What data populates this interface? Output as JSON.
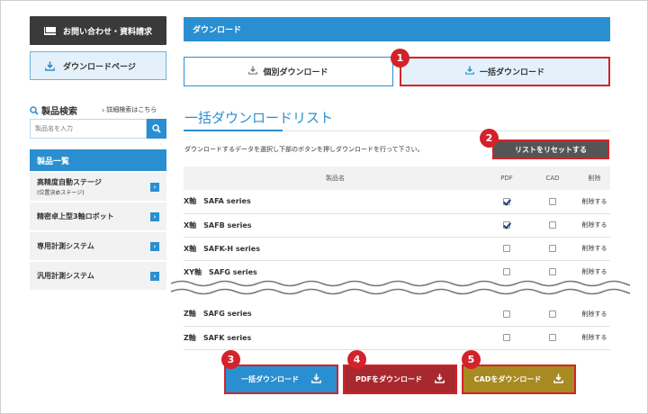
{
  "sidebar": {
    "contact_label": "お問い合わせ・資料請求",
    "download_page_label": "ダウンロードページ",
    "search_title": "製品検索",
    "advanced_search_link": "詳細検索はこちら",
    "search_placeholder": "製品名を入力",
    "category_header": "製品一覧",
    "categories": [
      {
        "label": "高精度自動ステージ",
        "sub": "(位置決めステージ)"
      },
      {
        "label": "精密卓上型3軸ロボット",
        "sub": ""
      },
      {
        "label": "専用計測システム",
        "sub": ""
      },
      {
        "label": "汎用計測システム",
        "sub": ""
      }
    ]
  },
  "main": {
    "header": "ダウンロード",
    "tabs": {
      "individual": "個別ダウンロード",
      "bulk": "一括ダウンロード"
    },
    "section_title": "一括ダウンロードリスト",
    "instruction": "ダウンロードするデータを選択し下部のボタンを押しダウンロードを行って下さい。",
    "reset_button": "リストをリセットする",
    "table": {
      "headers": {
        "name": "製品名",
        "pdf": "PDF",
        "cad": "CAD",
        "delete": "削除"
      },
      "rows": [
        {
          "axis": "X軸",
          "series": "SAFA series",
          "pdf": true,
          "cad": false,
          "delete": "削除する"
        },
        {
          "axis": "X軸",
          "series": "SAFB series",
          "pdf": true,
          "cad": false,
          "delete": "削除する"
        },
        {
          "axis": "X軸",
          "series": "SAFK-H series",
          "pdf": false,
          "cad": false,
          "delete": "削除する"
        },
        {
          "axis": "XY軸",
          "series": "SAFG series",
          "pdf": false,
          "cad": false,
          "delete": "削除する"
        },
        {
          "axis": "Z軸",
          "series": "SAFG series",
          "pdf": false,
          "cad": false,
          "delete": "削除する"
        },
        {
          "axis": "Z軸",
          "series": "SAFK series",
          "pdf": false,
          "cad": false,
          "delete": "削除する"
        }
      ]
    },
    "buttons": {
      "bulk_download": "一括ダウンロード",
      "pdf_download": "PDFをダウンロード",
      "cad_download": "CADをダウンロード"
    }
  },
  "callouts": [
    "1",
    "2",
    "3",
    "4",
    "5"
  ],
  "colors": {
    "accent_blue": "#2a8fd0",
    "highlight_red": "#d3222a",
    "pdf_button": "#a8282f",
    "cad_button": "#a88a22",
    "dark_button": "#555555"
  },
  "icons": {
    "contact": "mail-icon",
    "download": "download-icon",
    "search": "search-icon",
    "category_arrow": "chevron-right-icon"
  }
}
